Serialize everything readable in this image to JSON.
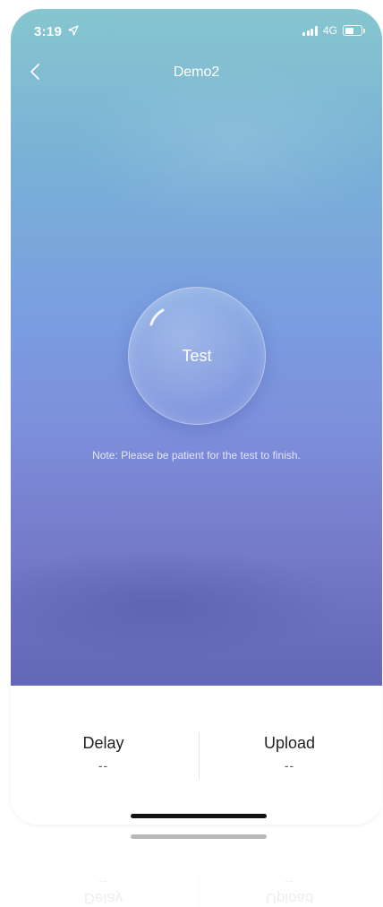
{
  "status_bar": {
    "time": "3:19",
    "network": "4G"
  },
  "nav": {
    "title": "Demo2"
  },
  "test": {
    "label": "Test",
    "note": "Note: Please be patient for the test to finish."
  },
  "stats": {
    "delay": {
      "label": "Delay",
      "value": "--"
    },
    "upload": {
      "label": "Upload",
      "value": "--"
    }
  },
  "ghost_stats": {
    "left": {
      "label": "Delay",
      "value": "--"
    },
    "right": {
      "label": "Upload",
      "value": "--"
    }
  },
  "icons": {
    "back": "chevron-left-icon",
    "location": "location-arrow-icon",
    "signal": "signal-bars-icon",
    "battery": "battery-icon"
  },
  "colors": {
    "gradient_top": "#86c6cf",
    "gradient_bottom": "#6466b8",
    "text_light": "#ffffff",
    "card_bg": "#ffffff"
  }
}
